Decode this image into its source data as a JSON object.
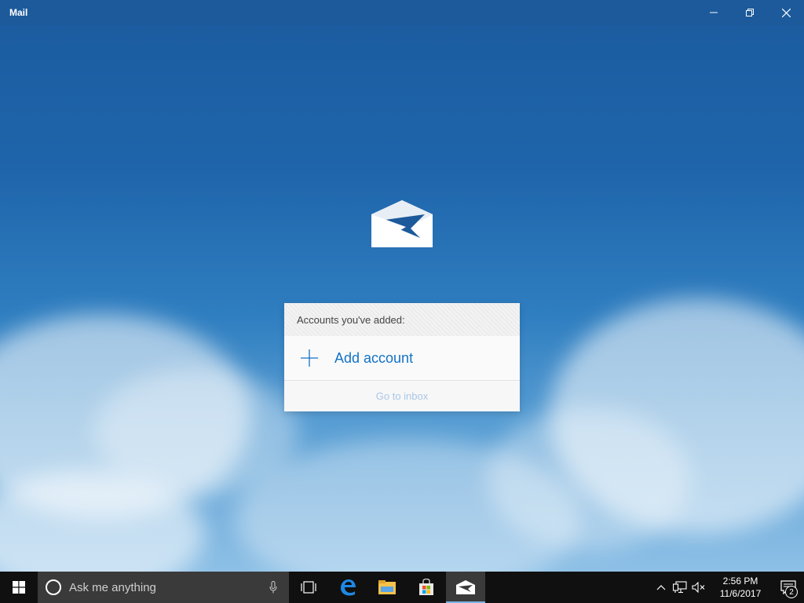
{
  "window": {
    "title": "Mail"
  },
  "card": {
    "header": "Accounts you've added:",
    "add_account": "Add account",
    "go_to_inbox": "Go to inbox"
  },
  "taskbar": {
    "search_placeholder": "Ask me anything",
    "pinned": [
      {
        "name": "task-view-icon"
      },
      {
        "name": "edge-icon"
      },
      {
        "name": "file-explorer-icon"
      },
      {
        "name": "store-icon"
      },
      {
        "name": "mail-icon",
        "active": true
      }
    ],
    "clock": {
      "time": "2:56 PM",
      "date": "11/6/2017"
    },
    "notification_count": "2"
  },
  "colors": {
    "accent": "#1372c6",
    "titlebar": "#1c5a9b",
    "taskbar": "#101010"
  }
}
